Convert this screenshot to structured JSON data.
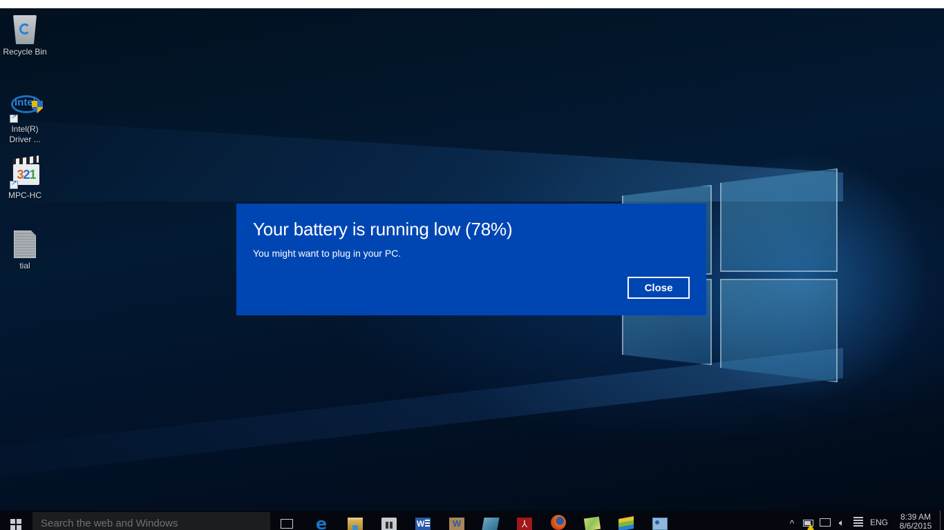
{
  "desktop": {
    "icons": [
      {
        "label": "Recycle Bin",
        "icon": "recycle-bin-icon"
      },
      {
        "label": "Intel(R) Driver ...",
        "label_line1": "Intel(R)",
        "label_line2": "Driver ...",
        "icon": "intel-driver-icon"
      },
      {
        "label": "MPC-HC",
        "icon": "mpc-hc-icon"
      },
      {
        "label": "tial",
        "icon": "text-document-icon"
      }
    ],
    "mpc_digits": [
      "3",
      "2",
      "1"
    ],
    "intel_word": "intel"
  },
  "dialog": {
    "title": "Your battery is running low (78%)",
    "battery_percent": 78,
    "message": "You might want to plug in your PC.",
    "close_label": "Close",
    "background_color": "#0046b3"
  },
  "taskbar": {
    "search_placeholder": "Search the web and Windows",
    "pinned_apps": [
      {
        "name": "task-view",
        "icon": "task-view-icon"
      },
      {
        "name": "microsoft-edge",
        "icon": "edge-icon",
        "glyph": "e"
      },
      {
        "name": "file-explorer",
        "icon": "folder-icon"
      },
      {
        "name": "store",
        "icon": "store-icon"
      },
      {
        "name": "microsoft-word",
        "icon": "word-icon",
        "glyph": "W"
      },
      {
        "name": "wordpad",
        "icon": "wordpad-icon",
        "glyph": "W"
      },
      {
        "name": "notepad",
        "icon": "notepad-icon"
      },
      {
        "name": "adobe-reader",
        "icon": "acrobat-icon",
        "glyph": "⅄"
      },
      {
        "name": "firefox",
        "icon": "firefox-icon"
      },
      {
        "name": "sticky-notes",
        "icon": "sticky-notes-icon"
      },
      {
        "name": "bluestacks",
        "icon": "bluestacks-icon"
      },
      {
        "name": "remote-desktop",
        "icon": "remote-desktop-icon"
      }
    ],
    "tray": {
      "chevron": "^",
      "volume_glyph": "🔈︎",
      "language": "ENG",
      "time": "8:39 AM",
      "date": "8/6/2015"
    }
  }
}
